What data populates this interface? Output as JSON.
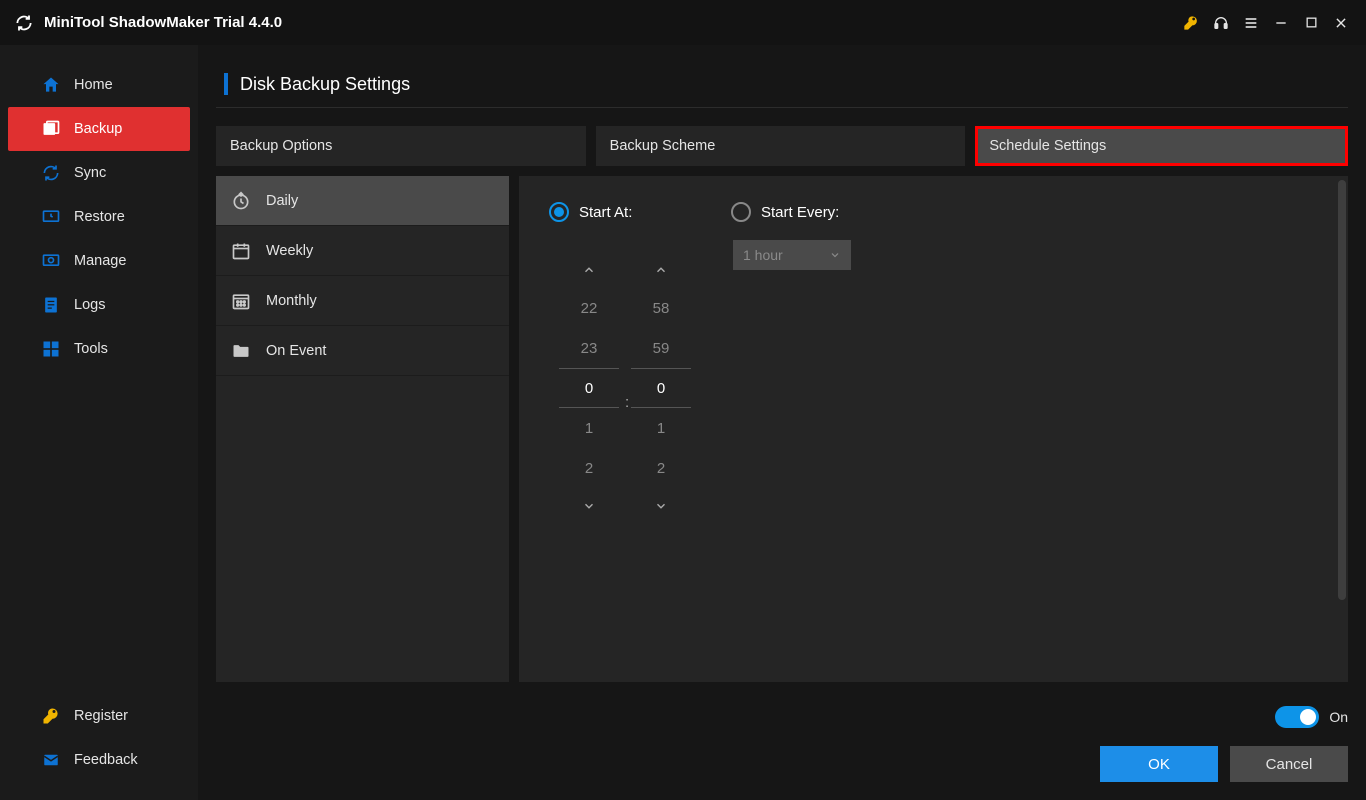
{
  "app": {
    "title": "MiniTool ShadowMaker Trial 4.4.0"
  },
  "titlebar_icons": {
    "key": "key-icon",
    "headset": "headset-icon",
    "menu": "menu-icon",
    "min": "minimize-icon",
    "max": "maximize-icon",
    "close": "close-icon"
  },
  "sidebar": {
    "items": [
      {
        "label": "Home",
        "icon": "home-icon"
      },
      {
        "label": "Backup",
        "icon": "backup-icon",
        "active": true
      },
      {
        "label": "Sync",
        "icon": "sync-icon"
      },
      {
        "label": "Restore",
        "icon": "restore-icon"
      },
      {
        "label": "Manage",
        "icon": "manage-icon"
      },
      {
        "label": "Logs",
        "icon": "logs-icon"
      },
      {
        "label": "Tools",
        "icon": "tools-icon"
      }
    ],
    "bottom": [
      {
        "label": "Register",
        "icon": "register-key-icon"
      },
      {
        "label": "Feedback",
        "icon": "feedback-mail-icon"
      }
    ]
  },
  "page": {
    "title": "Disk Backup Settings"
  },
  "tabs": [
    {
      "label": "Backup Options"
    },
    {
      "label": "Backup Scheme"
    },
    {
      "label": "Schedule Settings",
      "selected": true
    }
  ],
  "schedule_types": [
    {
      "label": "Daily",
      "icon": "clock-icon",
      "active": true
    },
    {
      "label": "Weekly",
      "icon": "calendar-icon"
    },
    {
      "label": "Monthly",
      "icon": "calendar-grid-icon"
    },
    {
      "label": "On Event",
      "icon": "folder-icon"
    }
  ],
  "radios": {
    "start_at": {
      "label": "Start At:",
      "checked": true
    },
    "start_every": {
      "label": "Start Every:",
      "checked": false
    }
  },
  "time_picker": {
    "hours": {
      "above2": "22",
      "above1": "23",
      "selected": "0",
      "below1": "1",
      "below2": "2"
    },
    "minutes": {
      "above2": "58",
      "above1": "59",
      "selected": "0",
      "below1": "1",
      "below2": "2"
    },
    "separator": ":"
  },
  "interval_select": {
    "value": "1 hour"
  },
  "toggle": {
    "label": "On",
    "on": true
  },
  "buttons": {
    "ok": "OK",
    "cancel": "Cancel"
  }
}
